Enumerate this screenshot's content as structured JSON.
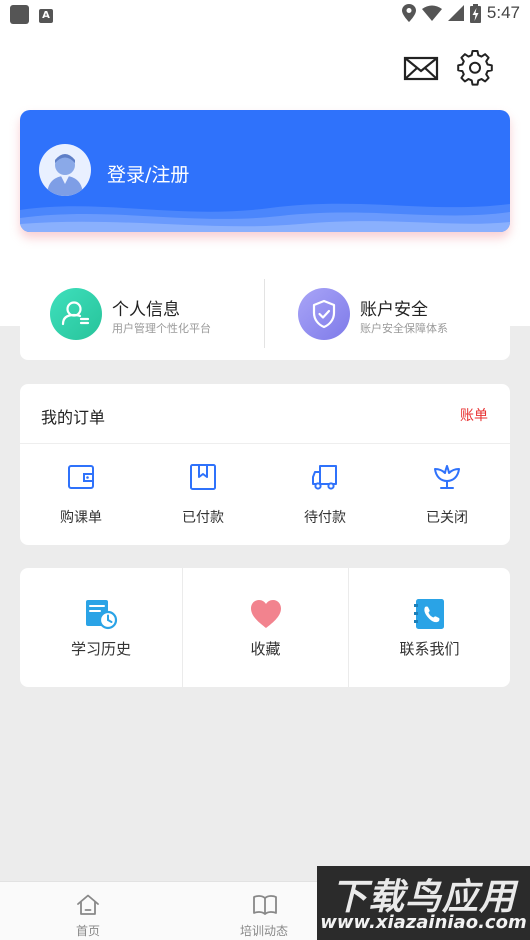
{
  "status_bar": {
    "time": "5:47",
    "badge_letter": "A"
  },
  "header": {
    "mail_icon": "mail-icon",
    "settings_icon": "gear-icon"
  },
  "login_card": {
    "label": "登录/注册",
    "accent": "#2f72fb"
  },
  "info": [
    {
      "title": "个人信息",
      "subtitle": "用户管理个性化平台",
      "icon": "user-profile-icon",
      "color": "#2fd3a8"
    },
    {
      "title": "账户安全",
      "subtitle": "账户安全保障体系",
      "icon": "shield-check-icon",
      "color": "#8e8cf0"
    }
  ],
  "orders": {
    "title": "我的订单",
    "bill_link": "账单",
    "items": [
      {
        "label": "购课单",
        "icon": "wallet-icon"
      },
      {
        "label": "已付款",
        "icon": "box-icon"
      },
      {
        "label": "待付款",
        "icon": "truck-icon"
      },
      {
        "label": "已关闭",
        "icon": "flower-icon"
      }
    ]
  },
  "services": [
    {
      "label": "学习历史",
      "icon": "study-history-icon"
    },
    {
      "label": "收藏",
      "icon": "heart-icon"
    },
    {
      "label": "联系我们",
      "icon": "phone-book-icon"
    }
  ],
  "bottom_nav": [
    {
      "label": "首页",
      "icon": "home-icon"
    },
    {
      "label": "培训动态",
      "icon": "book-icon"
    }
  ],
  "watermark": {
    "title": "下载鸟应用",
    "url": "www.xiazainiao.com"
  }
}
